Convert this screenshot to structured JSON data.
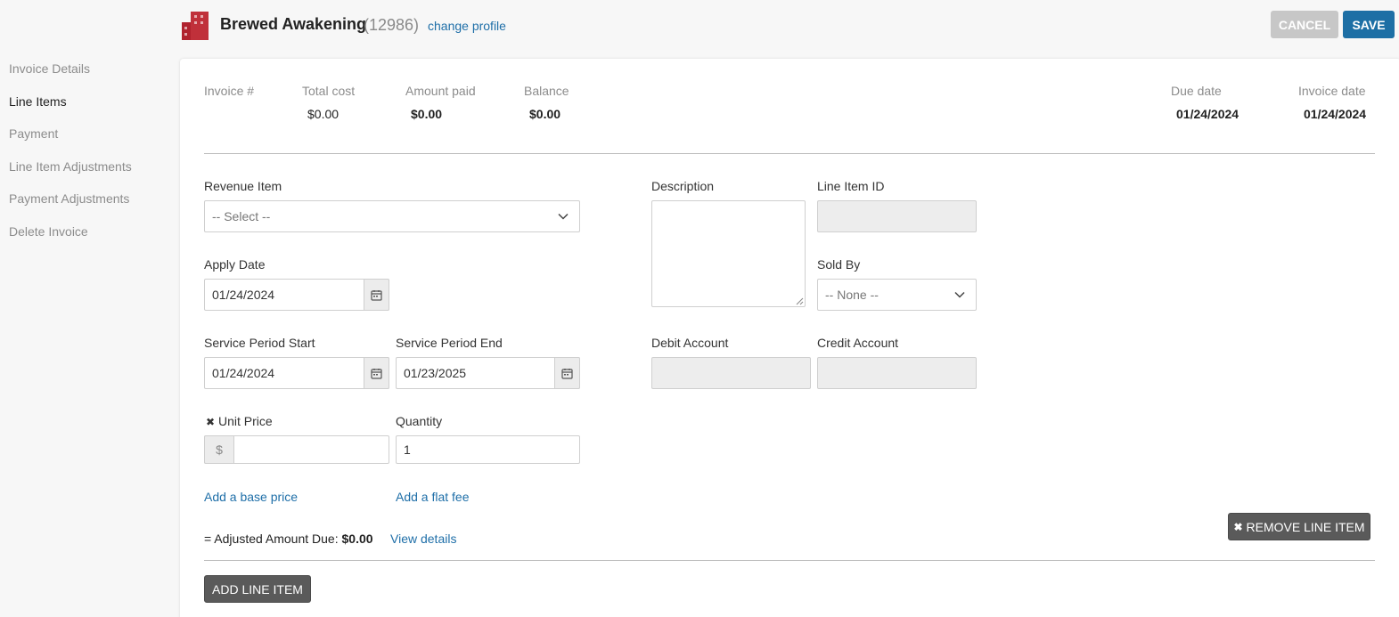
{
  "header": {
    "profile_name": "Brewed Awakening",
    "profile_id": "(12986)",
    "change_profile": "change profile",
    "cancel_label": "CANCEL",
    "save_label": "SAVE"
  },
  "sidebar": {
    "items": [
      {
        "label": "Invoice Details",
        "active": false
      },
      {
        "label": "Line Items",
        "active": true
      },
      {
        "label": "Payment",
        "active": false
      },
      {
        "label": "Line Item Adjustments",
        "active": false
      },
      {
        "label": "Payment Adjustments",
        "active": false
      },
      {
        "label": "Delete Invoice",
        "active": false
      }
    ]
  },
  "summary": {
    "invoice_num_label": "Invoice #",
    "invoice_num_value": "",
    "total_cost_label": "Total cost",
    "total_cost_value": "$0.00",
    "amount_paid_label": "Amount paid",
    "amount_paid_value": "$0.00",
    "balance_label": "Balance",
    "balance_value": "$0.00",
    "due_date_label": "Due date",
    "due_date_value": "01/24/2024",
    "invoice_date_label": "Invoice date",
    "invoice_date_value": "01/24/2024"
  },
  "form": {
    "revenue_item_label": "Revenue Item",
    "revenue_item_value": "-- Select --",
    "description_label": "Description",
    "description_value": "",
    "line_item_id_label": "Line Item ID",
    "line_item_id_value": "",
    "apply_date_label": "Apply Date",
    "apply_date_value": "01/24/2024",
    "sold_by_label": "Sold By",
    "sold_by_value": "-- None --",
    "service_start_label": "Service Period Start",
    "service_start_value": "01/24/2024",
    "service_end_label": "Service Period End",
    "service_end_value": "01/23/2025",
    "debit_account_label": "Debit Account",
    "credit_account_label": "Credit Account",
    "unit_price_label": "Unit Price",
    "unit_price_prefix": "$",
    "unit_price_value": "",
    "quantity_label": "Quantity",
    "quantity_value": "1",
    "add_base_price": "Add a base price",
    "add_flat_fee": "Add a flat fee",
    "adjusted_prefix": "= Adjusted Amount Due:",
    "adjusted_value": "$0.00",
    "view_details": "View details",
    "remove_line_item": "REMOVE LINE ITEM",
    "add_line_item": "ADD LINE ITEM"
  },
  "colors": {
    "accent": "#1d6fa5",
    "brand": "#b0222e",
    "dark_button": "#5a5a5a"
  }
}
